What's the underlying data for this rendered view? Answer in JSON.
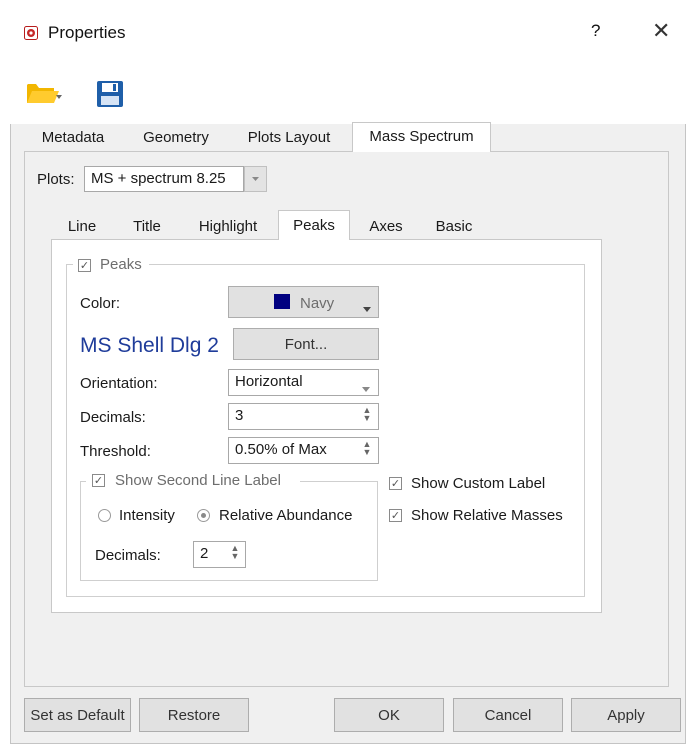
{
  "window": {
    "title": "Properties",
    "help": "?",
    "close": "✕"
  },
  "toolbar": {
    "open_icon": "folder-open-icon",
    "save_icon": "floppy-save-icon"
  },
  "tabs": [
    {
      "label": "Metadata"
    },
    {
      "label": "Geometry"
    },
    {
      "label": "Plots Layout"
    },
    {
      "label": "Mass Spectrum",
      "active": true
    }
  ],
  "plots": {
    "label": "Plots:",
    "value": "MS + spectrum 8.25"
  },
  "inner_tabs": [
    {
      "label": "Line"
    },
    {
      "label": "Title"
    },
    {
      "label": "Highlight"
    },
    {
      "label": "Peaks",
      "active": true
    },
    {
      "label": "Axes"
    },
    {
      "label": "Basic"
    }
  ],
  "peaks": {
    "group_label": "Peaks",
    "group_checked": true,
    "color_label": "Color:",
    "color_value": "Navy",
    "color_hex": "#000080",
    "font_preview": "MS Shell Dlg 2",
    "font_button": "Font...",
    "orientation_label": "Orientation:",
    "orientation_value": "Horizontal",
    "decimals_label": "Decimals:",
    "decimals_value": "3",
    "threshold_label": "Threshold:",
    "threshold_value": "0.50% of Max",
    "second_line": {
      "label": "Show Second Line Label",
      "checked": true,
      "radio_intensity": "Intensity",
      "radio_relative": "Relative Abundance",
      "selected": "Relative Abundance",
      "decimals_label": "Decimals:",
      "decimals_value": "2"
    },
    "show_custom_label": "Show Custom Label",
    "show_relative_masses": "Show Relative Masses"
  },
  "footer": {
    "set_default": "Set as Default",
    "restore": "Restore",
    "ok": "OK",
    "cancel": "Cancel",
    "apply": "Apply"
  }
}
